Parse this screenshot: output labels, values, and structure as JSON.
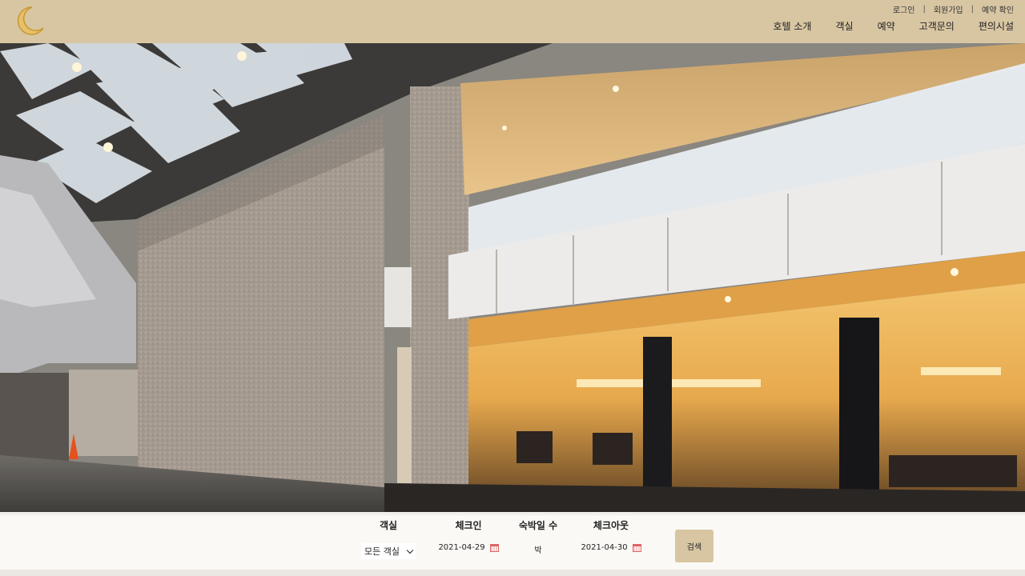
{
  "header": {
    "util_links": [
      {
        "label": "로그인"
      },
      {
        "label": "회원가입"
      },
      {
        "label": "예약 확인"
      }
    ],
    "nav": [
      {
        "label": "호텔 소개"
      },
      {
        "label": "객실"
      },
      {
        "label": "예약"
      },
      {
        "label": "고객문의"
      },
      {
        "label": "편의시설"
      }
    ],
    "logo_icon": "crescent-moon-icon",
    "bg_color": "#d8c6a3",
    "logo_color": "#e0b24a"
  },
  "booking": {
    "room": {
      "label": "객실",
      "value": "모든 객실"
    },
    "checkin": {
      "label": "체크인",
      "value": "2021-04-29"
    },
    "nights": {
      "label": "숙박일 수",
      "value": "박"
    },
    "checkout": {
      "label": "체크아웃",
      "value": "2021-04-30"
    },
    "search_label": "검색",
    "button_color": "#d8c6a3"
  }
}
